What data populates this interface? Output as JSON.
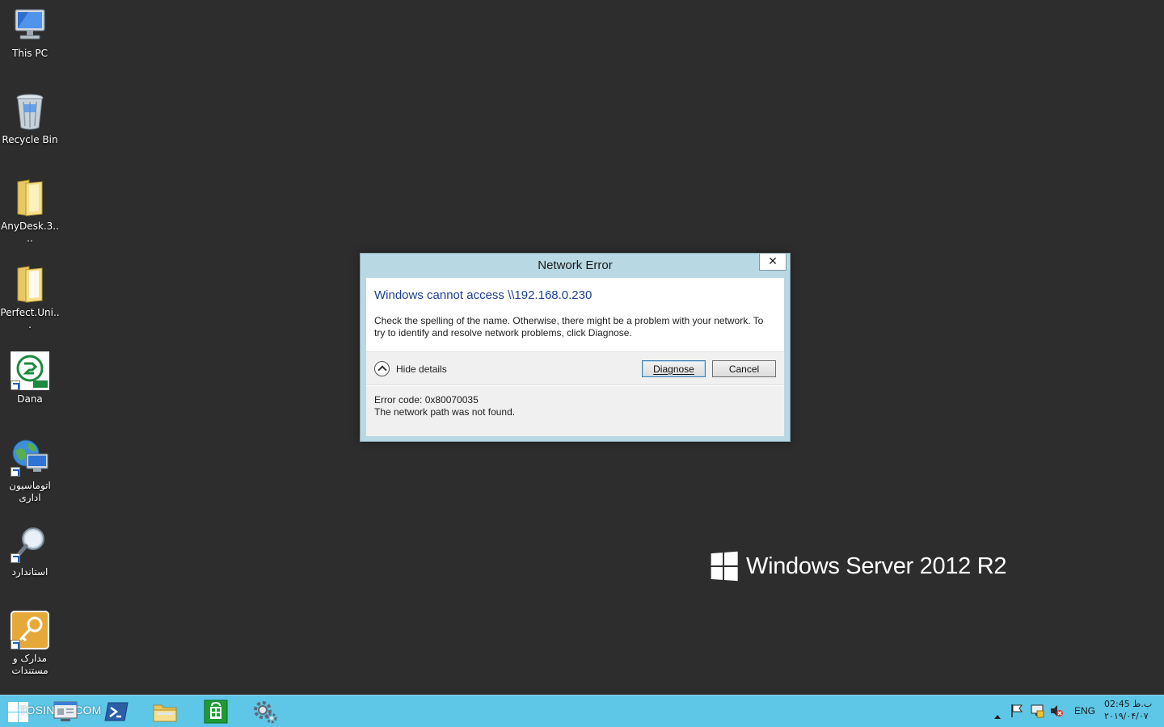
{
  "desktop": {
    "icons": [
      {
        "label": "This PC",
        "icon": "this-pc-icon"
      },
      {
        "label": "Recycle Bin",
        "icon": "recycle-bin-icon"
      },
      {
        "label": "AnyDesk.3....",
        "icon": "folder-icon"
      },
      {
        "label": "Perfect.Uni...",
        "icon": "folder-icon"
      },
      {
        "label": "Dana",
        "icon": "dana-app-icon"
      },
      {
        "label": "اتوماسیون اداری",
        "icon": "automation-globe-icon"
      },
      {
        "label": "استاندارد",
        "icon": "magnifier-icon"
      },
      {
        "label": "مدارک و مستندات",
        "icon": "key-icon"
      }
    ],
    "branding": "Windows Server 2012 R2"
  },
  "dialog": {
    "title": "Network Error",
    "close_label": "✕",
    "main_instruction": "Windows cannot access \\\\192.168.0.230",
    "content": "Check the spelling of the name. Otherwise, there might be a problem with your network. To try to identify and resolve network problems, click Diagnose.",
    "toggle_label": "Hide details",
    "diagnose_label": "Diagnose",
    "cancel_label": "Cancel",
    "error_code": "Error code: 0x80070035",
    "error_message": "The network path was not found."
  },
  "taskbar": {
    "watermark": "TOSINSO.COM",
    "apps": [
      "server-manager-icon",
      "powershell-icon",
      "file-explorer-icon",
      "store-icon",
      "settings-gear-icon"
    ],
    "tray": {
      "language": "ENG",
      "time": "02:45 ب.ظ",
      "date": "۲۰۱۹/۰۴/۰۷"
    }
  },
  "colors": {
    "desktop_bg": "#2d2d2d",
    "dialog_frame": "#b8d8e3",
    "main_instruction": "#1c3f94",
    "taskbar": "#5ec6e6"
  }
}
